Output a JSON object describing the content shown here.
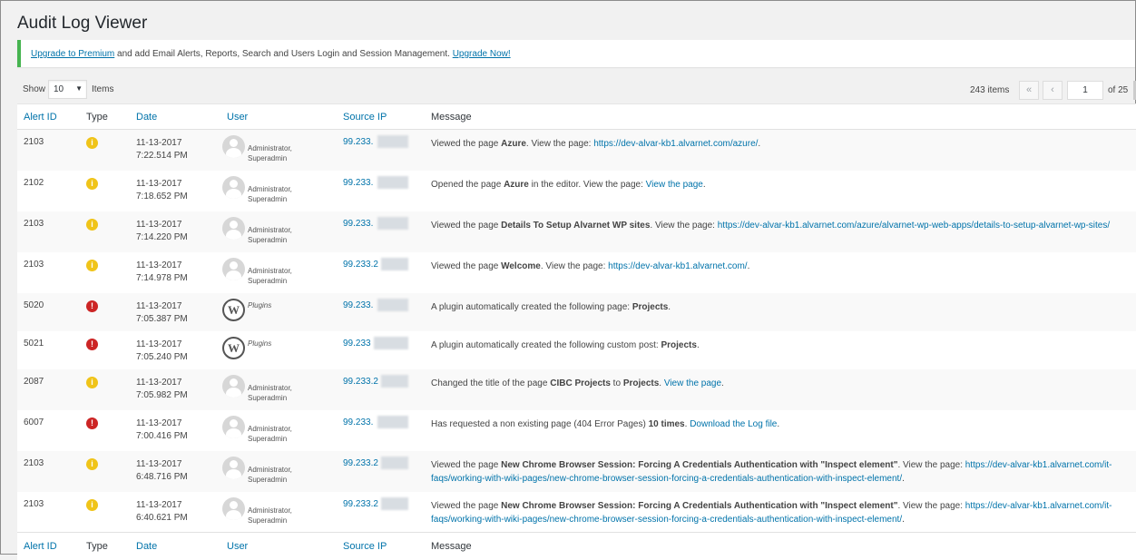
{
  "page": {
    "title": "Audit Log Viewer"
  },
  "notice": {
    "upgrade_link": "Upgrade to Premium",
    "text": " and add Email Alerts, Reports, Search and Users Login and Session Management. ",
    "upgrade_now": "Upgrade Now!"
  },
  "tablenav": {
    "show_label": "Show",
    "per_page": "10",
    "items_label": "Items",
    "total_items": "243 items",
    "first_page": "«",
    "prev_page": "‹",
    "current_page": "1",
    "of_pages": "of 25"
  },
  "columns": {
    "alert_id": "Alert ID",
    "type": "Type",
    "date": "Date",
    "user": "User",
    "source_ip": "Source IP",
    "message": "Message"
  },
  "rows": [
    {
      "id": "2103",
      "type": "info",
      "date": "11-13-2017",
      "time": "7:22.514 PM",
      "user_kind": "avatar",
      "user1": "Administrator,",
      "user2": "Superadmin",
      "ip": "99.233.",
      "msg_pre": "Viewed the page ",
      "msg_bold": "Azure",
      "msg_mid": ". View the page: ",
      "msg_link": "https://dev-alvar-kb1.alvarnet.com/azure/",
      "msg_post": "."
    },
    {
      "id": "2102",
      "type": "info",
      "date": "11-13-2017",
      "time": "7:18.652 PM",
      "user_kind": "avatar",
      "user1": "Administrator,",
      "user2": "Superadmin",
      "ip": "99.233.",
      "msg_pre": "Opened the page ",
      "msg_bold": "Azure",
      "msg_mid": " in the editor. View the page: ",
      "msg_link": "View the page",
      "msg_post": "."
    },
    {
      "id": "2103",
      "type": "info",
      "date": "11-13-2017",
      "time": "7:14.220 PM",
      "user_kind": "avatar",
      "user1": "Administrator,",
      "user2": "Superadmin",
      "ip": "99.233.",
      "msg_pre": "Viewed the page ",
      "msg_bold": "Details To Setup Alvarnet WP sites",
      "msg_mid": ". View the page: ",
      "msg_link": "https://dev-alvar-kb1.alvarnet.com/azure/alvarnet-wp-web-apps/details-to-setup-alvarnet-wp-sites/",
      "msg_post": ""
    },
    {
      "id": "2103",
      "type": "info",
      "date": "11-13-2017",
      "time": "7:14.978 PM",
      "user_kind": "avatar",
      "user1": "Administrator,",
      "user2": "Superadmin",
      "ip": "99.233.2",
      "msg_pre": "Viewed the page ",
      "msg_bold": "Welcome",
      "msg_mid": ". View the page: ",
      "msg_link": "https://dev-alvar-kb1.alvarnet.com/",
      "msg_post": "."
    },
    {
      "id": "5020",
      "type": "crit",
      "date": "11-13-2017",
      "time": "7:05.387 PM",
      "user_kind": "plugin",
      "user1": "Plugins",
      "user2": "",
      "ip": "99.233.",
      "msg_pre": "A plugin automatically created the following page: ",
      "msg_bold": "Projects",
      "msg_mid": ".",
      "msg_link": "",
      "msg_post": ""
    },
    {
      "id": "5021",
      "type": "crit",
      "date": "11-13-2017",
      "time": "7:05.240 PM",
      "user_kind": "plugin",
      "user1": "Plugins",
      "user2": "",
      "ip": "99.233",
      "msg_pre": "A plugin automatically created the following custom post: ",
      "msg_bold": "Projects",
      "msg_mid": ".",
      "msg_link": "",
      "msg_post": ""
    },
    {
      "id": "2087",
      "type": "info",
      "date": "11-13-2017",
      "time": "7:05.982 PM",
      "user_kind": "avatar",
      "user1": "Administrator,",
      "user2": "Superadmin",
      "ip": "99.233.2",
      "msg_pre": "Changed the title of the page ",
      "msg_bold": "CIBC Projects",
      "msg_mid": " to ",
      "msg_bold2": "Projects",
      "msg_mid2": ". ",
      "msg_link": "View the page",
      "msg_post": "."
    },
    {
      "id": "6007",
      "type": "crit",
      "date": "11-13-2017",
      "time": "7:00.416 PM",
      "user_kind": "avatar",
      "user1": "Administrator,",
      "user2": "Superadmin",
      "ip": "99.233.",
      "msg_pre": "Has requested a non existing page (404 Error Pages) ",
      "msg_bold": "10 times",
      "msg_mid": ". ",
      "msg_link": "Download the Log file",
      "msg_post": "."
    },
    {
      "id": "2103",
      "type": "info",
      "date": "11-13-2017",
      "time": "6:48.716 PM",
      "user_kind": "avatar",
      "user1": "Administrator,",
      "user2": "Superadmin",
      "ip": "99.233.2",
      "msg_pre": "Viewed the page ",
      "msg_bold": "New Chrome Browser Session: Forcing A Credentials Authentication with \"Inspect element\"",
      "msg_mid": ". View the page: ",
      "msg_link": "https://dev-alvar-kb1.alvarnet.com/it-faqs/working-with-wiki-pages/new-chrome-browser-session-forcing-a-credentials-authentication-with-inspect-element/",
      "msg_post": "."
    },
    {
      "id": "2103",
      "type": "info",
      "date": "11-13-2017",
      "time": "6:40.621 PM",
      "user_kind": "avatar",
      "user1": "Administrator,",
      "user2": "Superadmin",
      "ip": "99.233.2",
      "msg_pre": "Viewed the page ",
      "msg_bold": "New Chrome Browser Session: Forcing A Credentials Authentication with \"Inspect element\"",
      "msg_mid": ". View the page: ",
      "msg_link": "https://dev-alvar-kb1.alvarnet.com/it-faqs/working-with-wiki-pages/new-chrome-browser-session-forcing-a-credentials-authentication-with-inspect-element/",
      "msg_post": "."
    }
  ],
  "colors": {
    "accent": "#0073aa",
    "notice_border": "#46b450",
    "info": "#f0c419",
    "critical": "#cc2525"
  }
}
